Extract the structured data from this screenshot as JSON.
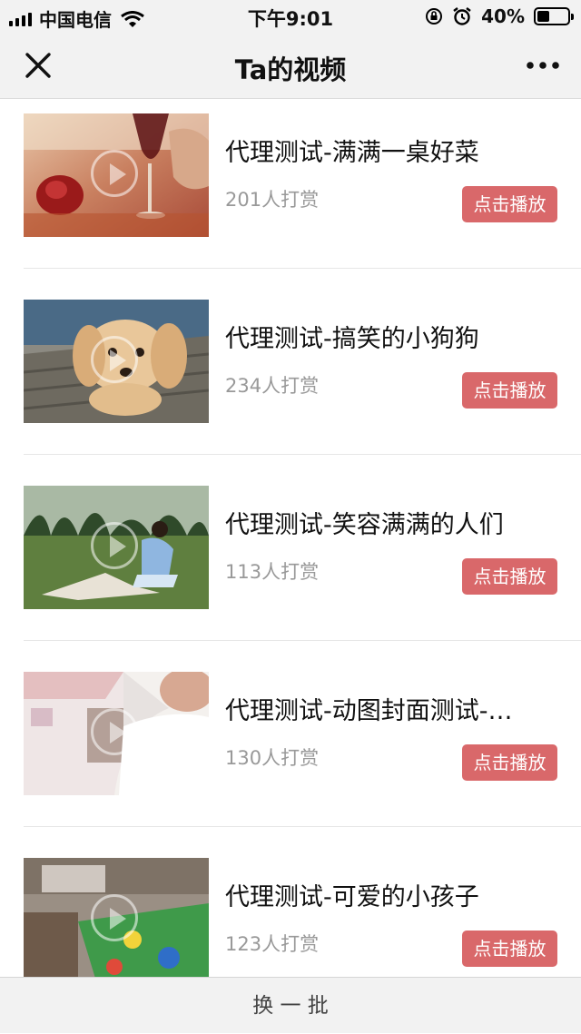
{
  "status_bar": {
    "carrier": "中国电信",
    "time": "下午9:01",
    "battery_pct": "40%",
    "battery_level": 0.4
  },
  "nav": {
    "title": "Ta的视频"
  },
  "videos": [
    {
      "title": "代理测试-满满一桌好菜",
      "reward": "201人打赏",
      "play_label": "点击播放"
    },
    {
      "title": "代理测试-搞笑的小狗狗",
      "reward": "234人打赏",
      "play_label": "点击播放"
    },
    {
      "title": "代理测试-笑容满满的人们",
      "reward": "113人打赏",
      "play_label": "点击播放"
    },
    {
      "title": "代理测试-动图封面测试-…",
      "reward": "130人打赏",
      "play_label": "点击播放"
    },
    {
      "title": "代理测试-可爱的小孩子",
      "reward": "123人打赏",
      "play_label": "点击播放"
    }
  ],
  "footer": {
    "refresh_label": "换 一 批"
  },
  "colors": {
    "accent": "#d9686a",
    "bar_bg": "#f2f2f2"
  }
}
